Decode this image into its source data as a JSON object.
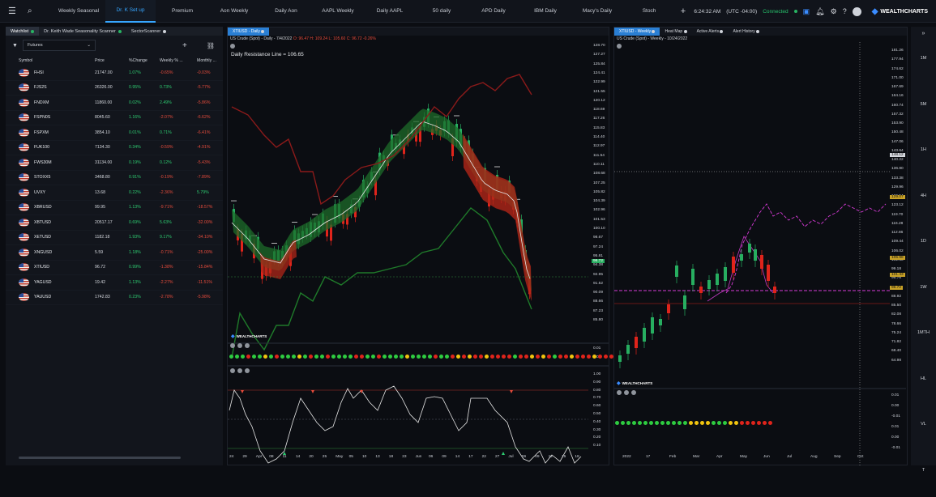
{
  "topbar": {
    "tabs": [
      "Weekly Seasonal",
      "Dr. K Set up",
      "Premium",
      "Aon Weekly",
      "Daily Aon",
      "AAPL Weekly",
      "Daily AAPL",
      "50 daily",
      "APD Daily",
      "IBM Daily",
      "Macy's Daily",
      "Stoch"
    ],
    "active_tab": 1,
    "time": "6:24:32 AM",
    "timezone": "(UTC -04:00)",
    "status": "Connected",
    "logo": "WEALTHCHARTS"
  },
  "watchlist": {
    "tabs": [
      "Watchlist",
      "Dr. Keith Wade Seasonality Scanner",
      "SectorScanner"
    ],
    "list_select": "Futures",
    "columns": [
      "Symbol",
      "Price",
      "%Change",
      "Weekly % ...",
      "Monthly ..."
    ],
    "rows": [
      {
        "symbol": "FHSI",
        "price": "21747.00",
        "change": "1.07%",
        "weekly": "-0.65%",
        "monthly": "-0.03%"
      },
      {
        "symbol": "FJS2S",
        "price": "26326.00",
        "change": "0.95%",
        "weekly": "0.73%",
        "monthly": "-5.77%"
      },
      {
        "symbol": "FNDXM",
        "price": "11860.00",
        "change": "0.02%",
        "weekly": "2.49%",
        "monthly": "-5.86%"
      },
      {
        "symbol": "FSPN0S",
        "price": "8045.60",
        "change": "1.16%",
        "weekly": "-2.07%",
        "monthly": "-6.62%"
      },
      {
        "symbol": "FSPXM",
        "price": "3854.10",
        "change": "0.01%",
        "weekly": "0.71%",
        "monthly": "-6.41%"
      },
      {
        "symbol": "FUK100",
        "price": "7134.30",
        "change": "0.34%",
        "weekly": "-0.59%",
        "monthly": "-4.91%"
      },
      {
        "symbol": "FWS30M",
        "price": "31134.00",
        "change": "0.19%",
        "weekly": "0.12%",
        "monthly": "-5.43%"
      },
      {
        "symbol": "STOXX5",
        "price": "3468.80",
        "change": "0.91%",
        "weekly": "-0.19%",
        "monthly": "-7.89%"
      },
      {
        "symbol": "UVXY",
        "price": "13.68",
        "change": "0.22%",
        "weekly": "-2.36%",
        "monthly": "5.79%"
      },
      {
        "symbol": "XBRUSD",
        "price": "99.95",
        "change": "1.13%",
        "weekly": "-9.71%",
        "monthly": "-18.57%"
      },
      {
        "symbol": "XBTUSD",
        "price": "20517.17",
        "change": "0.69%",
        "weekly": "5.63%",
        "monthly": "-32.00%"
      },
      {
        "symbol": "XETUSD",
        "price": "1182.18",
        "change": "1.93%",
        "weekly": "9.17%",
        "monthly": "-34.10%"
      },
      {
        "symbol": "XNGUSD",
        "price": "5.59",
        "change": "1.18%",
        "weekly": "-0.71%",
        "monthly": "-25.00%"
      },
      {
        "symbol": "XTIUSD",
        "price": "96.72",
        "change": "0.99%",
        "weekly": "-1.38%",
        "monthly": "-15.84%"
      },
      {
        "symbol": "YAGUSD",
        "price": "19.42",
        "change": "1.13%",
        "weekly": "-2.27%",
        "monthly": "-11.51%"
      },
      {
        "symbol": "YAUUSD",
        "price": "1742.83",
        "change": "0.23%",
        "weekly": "-2.78%",
        "monthly": "-5.98%"
      }
    ]
  },
  "daily_chart": {
    "tab": "XTIUSD - Daily",
    "info": "US Crude (Spot) - Daily - 7/4/2022",
    "ohlc": "O: 96.47 H: 109.24 L: 105.60 C: 96.72 -0.26%",
    "annotation": "Daily Resistance Line = 106.65",
    "price_axis": [
      "128.70",
      "127.27",
      "125.84",
      "124.41",
      "122.99",
      "121.55",
      "120.12",
      "118.69",
      "117.26",
      "115.83",
      "114.40",
      "112.97",
      "111.54",
      "110.11",
      "108.68",
      "107.25",
      "105.82",
      "104.39",
      "102.96",
      "101.53",
      "100.10",
      "98.67",
      "97.24",
      "95.81",
      "94.38",
      "92.95",
      "91.52",
      "90.09",
      "88.66",
      "87.23",
      "85.80"
    ],
    "last_price": "96.72",
    "date_axis": [
      "24",
      "29",
      "Apr",
      "08",
      "11",
      "14",
      "20",
      "25",
      "May",
      "05",
      "10",
      "13",
      "18",
      "23",
      "Jun",
      "06",
      "09",
      "14",
      "17",
      "22",
      "27",
      "Jul",
      "06",
      "09",
      "12",
      "15",
      "18"
    ],
    "indicator_axis": [
      "0.01",
      "0.00"
    ],
    "stoch_axis": [
      "1.00",
      "0.90",
      "0.80",
      "0.70",
      "0.60",
      "0.50",
      "0.40",
      "0.30",
      "0.20",
      "0.10"
    ],
    "logo": "WEALTHCHARTS",
    "signal_dots": [
      "g",
      "g",
      "g",
      "r",
      "g",
      "g",
      "y",
      "g",
      "r",
      "g",
      "g",
      "g",
      "y",
      "g",
      "r",
      "g",
      "g",
      "r",
      "g",
      "g",
      "g",
      "g",
      "r",
      "r",
      "g",
      "g",
      "r",
      "g",
      "g",
      "g",
      "g",
      "y",
      "g",
      "g",
      "g",
      "g",
      "r",
      "g",
      "g",
      "r",
      "y",
      "r",
      "y",
      "r",
      "r",
      "y",
      "r",
      "r",
      "r",
      "r",
      "g",
      "r",
      "r",
      "y",
      "r",
      "y",
      "r",
      "g",
      "r",
      "r",
      "y",
      "r",
      "r",
      "r",
      "y",
      "r",
      "r",
      "r",
      "r",
      "r",
      "g",
      "r",
      "r",
      "r",
      "r"
    ]
  },
  "weekly_chart": {
    "tabs": [
      "XTIUSD - Weekly",
      "Heat Map",
      "Active Alerts",
      "Alert History"
    ],
    "info": "US Crude (Spot) - Weekly - 10/24/2022",
    "price_axis": [
      "181.26",
      "177.94",
      "174.62",
      "171.00",
      "167.69",
      "164.16",
      "160.74",
      "157.32",
      "153.90",
      "150.48",
      "147.06",
      "143.64",
      "140.22",
      "136.80",
      "133.38",
      "129.96",
      "126.54",
      "123.12",
      "119.70",
      "116.28",
      "112.86",
      "109.44",
      "106.02",
      "102.60",
      "99.18",
      "95.76",
      "92.34",
      "88.92",
      "85.50",
      "82.08",
      "78.66",
      "75.24",
      "71.82",
      "68.40",
      "64.98"
    ],
    "crosshair_price": "148.12",
    "tag1": "129.07",
    "tag2": "105.98",
    "tag3": "101.43",
    "tag4": "96.72",
    "date_axis": [
      "2022",
      "17",
      "Feb",
      "Mar",
      "Apr",
      "May",
      "Jun",
      "Jul",
      "Aug",
      "Sep",
      "Oct"
    ],
    "indicator_axis": [
      "0.01",
      "0.00",
      "-0.01",
      "0.01",
      "0.00",
      "-0.01"
    ],
    "logo": "WEALTHCHARTS",
    "signal_dots": [
      "g",
      "g",
      "g",
      "g",
      "g",
      "g",
      "g",
      "g",
      "g",
      "g",
      "g",
      "g",
      "g",
      "y",
      "y",
      "y",
      "y",
      "g",
      "g",
      "g",
      "y",
      "y",
      "r",
      "r",
      "r",
      "r",
      "r",
      "r"
    ]
  },
  "timeframes": [
    "1M",
    "5M",
    "1H",
    "4H",
    "1D",
    "1W",
    "1MTH",
    "HL",
    "VL",
    "T"
  ],
  "colors": {
    "accent": "#2a7fd4",
    "bull": "#27ae60",
    "bear": "#e74c3c",
    "upper_band": "#8b1a1a",
    "lower_band": "#1f7a2a",
    "magenta": "#d63ad6"
  }
}
